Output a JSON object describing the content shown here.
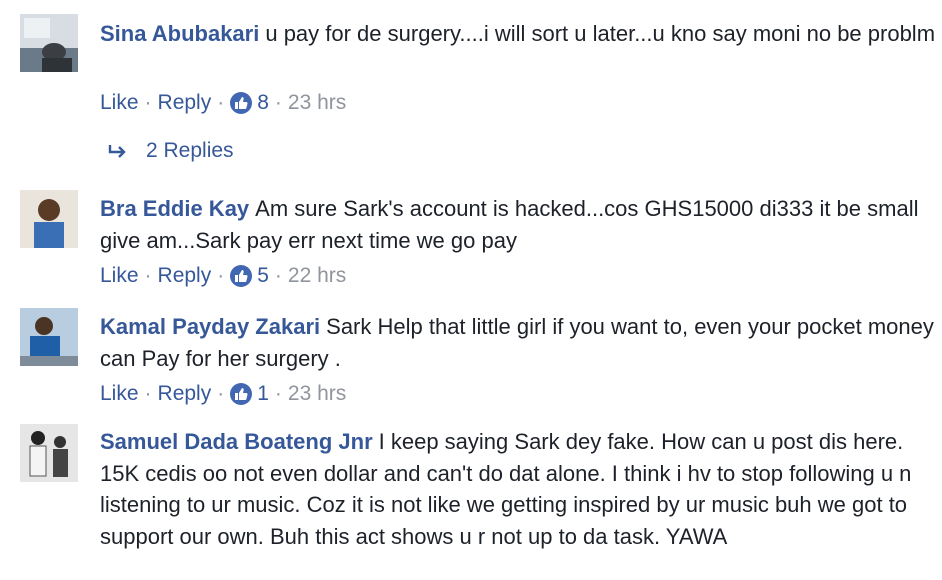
{
  "comments": [
    {
      "author": "Sina Abubakari",
      "text": "u pay for de surgery....i will sort u later...u kno say moni no be problm",
      "like_label": "Like",
      "reply_label": "Reply",
      "like_count": "8",
      "time": "23 hrs",
      "replies_label": "2 Replies"
    },
    {
      "author": "Bra Eddie Kay",
      "text": "Am sure Sark's account is hacked...cos GHS15000 di333 it be small give am...Sark pay err next time we go pay",
      "like_label": "Like",
      "reply_label": "Reply",
      "like_count": "5",
      "time": "22 hrs"
    },
    {
      "author": "Kamal Payday Zakari",
      "text": "Sark Help that little girl if you want to, even your pocket money can Pay for her surgery .",
      "like_label": "Like",
      "reply_label": "Reply",
      "like_count": "1",
      "time": "23 hrs"
    },
    {
      "author": "Samuel Dada Boateng Jnr",
      "text": "I keep saying Sark dey fake. How can u post dis here. 15K cedis oo not even dollar and can't do dat alone. I think i hv to stop following u n listening to ur music. Coz it is not like we getting inspired by ur music buh we got to support our own. Buh this act shows u r not up to da task. YAWA"
    }
  ],
  "separator": "·",
  "colors": {
    "link": "#365899",
    "text": "#1d2129",
    "meta": "#90949c",
    "like_badge": "#4267b2"
  },
  "icons": {
    "like": "thumbs-up-icon",
    "reply_arrow": "reply-arrow-icon"
  }
}
